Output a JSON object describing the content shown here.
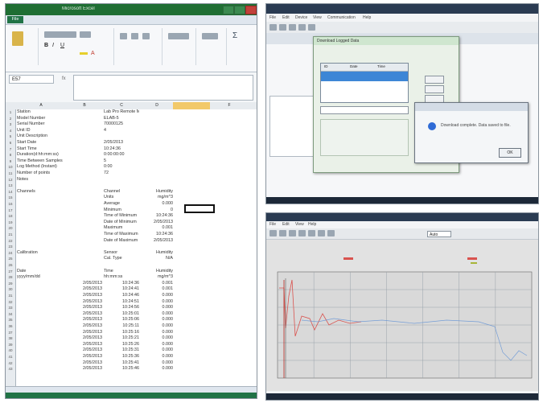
{
  "excel": {
    "title": "Microsoft Excel",
    "file_tab": "File",
    "name_box": "E57",
    "fx_label": "fx",
    "rows": [
      {
        "num": "1",
        "a": "Station",
        "c": "Lab Pro Remote Monitor"
      },
      {
        "num": "2",
        "a": "Model Number",
        "c": "ELAB-5"
      },
      {
        "num": "3",
        "a": "Serial Number",
        "c": "70000125"
      },
      {
        "num": "4",
        "a": "Unit ID",
        "c": "4"
      },
      {
        "num": "5",
        "a": "Unit Description",
        "c": ""
      },
      {
        "num": "6",
        "a": "Start Date",
        "c": "2/05/2013"
      },
      {
        "num": "7",
        "a": "Start Time",
        "c": "10:24:36"
      },
      {
        "num": "8",
        "a": "Duration(d:hh:mm:ss)",
        "c": "0:00:00:00"
      },
      {
        "num": "9",
        "a": "Time Between Samples",
        "c": "5"
      },
      {
        "num": "10",
        "a": "Log Method (Instant)",
        "c": "0:00"
      },
      {
        "num": "11",
        "a": "Number of points",
        "c": "72"
      },
      {
        "num": "12",
        "a": "Notes",
        "c": ""
      },
      {
        "num": "13",
        "a": "",
        "c": ""
      },
      {
        "num": "14",
        "a": "Channels",
        "c": "Channel",
        "d": "Humidity"
      },
      {
        "num": "15",
        "a": "",
        "c": "Units",
        "d": "mg/m^3"
      },
      {
        "num": "16",
        "a": "",
        "c": "Average",
        "d": "0.000"
      },
      {
        "num": "17",
        "a": "",
        "c": "Minimum",
        "d": "0"
      },
      {
        "num": "18",
        "a": "",
        "c": "Time of Minimum",
        "d": "10:24:36"
      },
      {
        "num": "19",
        "a": "",
        "c": "Date of Minimum",
        "d": "2/05/2013"
      },
      {
        "num": "20",
        "a": "",
        "c": "Maximum",
        "d": "0.001"
      },
      {
        "num": "21",
        "a": "",
        "c": "Time of Maximum",
        "d": "10:24:36"
      },
      {
        "num": "22",
        "a": "",
        "c": "Date of Maximum",
        "d": "2/05/2013"
      },
      {
        "num": "23",
        "a": "",
        "c": "",
        "d": ""
      },
      {
        "num": "24",
        "a": "Calibration",
        "c": "Sensor",
        "d": "Humidity"
      },
      {
        "num": "25",
        "a": "",
        "c": "Cal. Type",
        "d": "N/A"
      },
      {
        "num": "26",
        "a": "",
        "c": "",
        "d": ""
      },
      {
        "num": "27",
        "a": "Date",
        "c": "Time",
        "d": "Humidity"
      },
      {
        "num": "28",
        "a": "yyyy/mm/dd",
        "c": "hh:mm:ss",
        "d": "mg/m^3"
      },
      {
        "num": "29",
        "b": "2/05/2013",
        "c": "10:24:36",
        "d": "0.001"
      },
      {
        "num": "30",
        "b": "2/05/2013",
        "c": "10:24:41",
        "d": "0.001"
      },
      {
        "num": "31",
        "b": "2/05/2013",
        "c": "10:24:46",
        "d": "0.000"
      },
      {
        "num": "32",
        "b": "2/05/2013",
        "c": "10:24:51",
        "d": "0.000"
      },
      {
        "num": "33",
        "b": "2/05/2013",
        "c": "10:24:56",
        "d": "0.000"
      },
      {
        "num": "34",
        "b": "2/05/2013",
        "c": "10:25:01",
        "d": "0.000"
      },
      {
        "num": "35",
        "b": "2/05/2013",
        "c": "10:25:06",
        "d": "0.000"
      },
      {
        "num": "36",
        "b": "2/05/2013",
        "c": "10:25:11",
        "d": "0.000"
      },
      {
        "num": "37",
        "b": "2/05/2013",
        "c": "10:25:16",
        "d": "0.000"
      },
      {
        "num": "38",
        "b": "2/05/2013",
        "c": "10:25:21",
        "d": "0.000"
      },
      {
        "num": "39",
        "b": "2/05/2013",
        "c": "10:25:26",
        "d": "0.000"
      },
      {
        "num": "40",
        "b": "2/05/2013",
        "c": "10:25:31",
        "d": "0.000"
      },
      {
        "num": "41",
        "b": "2/05/2013",
        "c": "10:25:36",
        "d": "0.000"
      },
      {
        "num": "42",
        "b": "2/05/2013",
        "c": "10:25:41",
        "d": "0.000"
      },
      {
        "num": "43",
        "b": "2/05/2013",
        "c": "10:25:46",
        "d": "0.000"
      }
    ],
    "col_heads": [
      "A",
      "B",
      "C",
      "D",
      "E",
      "F"
    ]
  },
  "app1": {
    "menu": [
      "File",
      "Edit",
      "Device",
      "View",
      "Communication",
      "Help"
    ],
    "dialog_title": "Download Logged Data",
    "dialog_list_header": [
      "ID",
      "Date",
      "Time"
    ],
    "buttons": [
      "Download",
      "Delete",
      "Cancel"
    ],
    "message_text": "Download complete. Data saved to file.",
    "ok_label": "OK"
  },
  "app2": {
    "menu": [
      "File",
      "Edit",
      "View",
      "Help"
    ],
    "zoom_value": "Auto",
    "colors": {
      "red_series": "#d9534f",
      "blue_series": "#5b8fd6",
      "grid": "#9aa3ab",
      "plot_bg": "#d9d9d9"
    }
  }
}
